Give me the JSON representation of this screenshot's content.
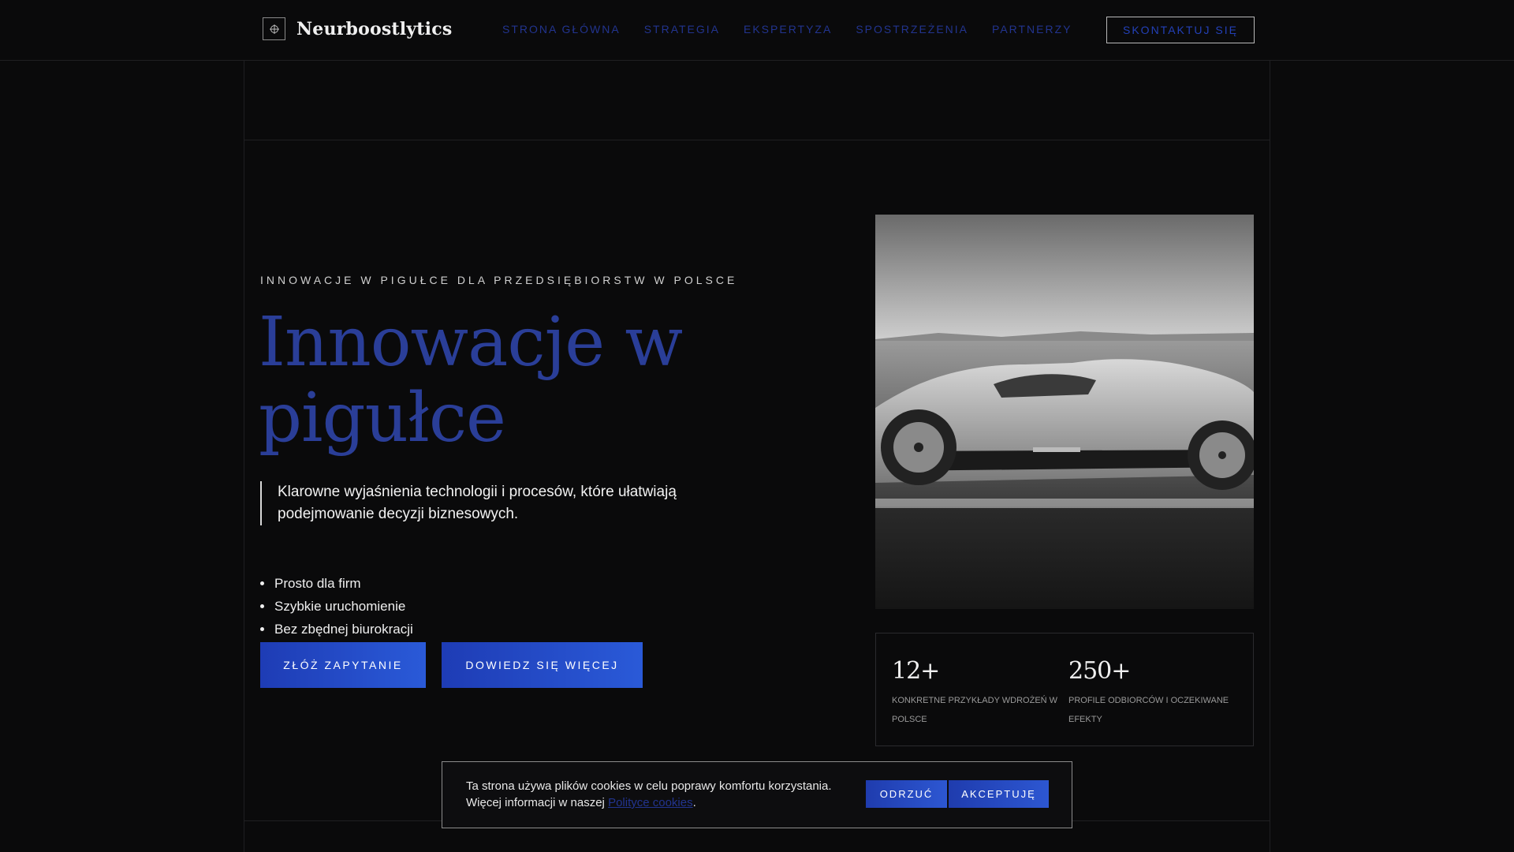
{
  "brand": {
    "name": "Neurboostlytics",
    "icon": "crosshair-icon"
  },
  "nav": {
    "items": [
      "STRONA GŁÓWNA",
      "STRATEGIA",
      "EKSPERTYZA",
      "SPOSTRZEŻENIA",
      "PARTNERZY"
    ],
    "cta": "SKONTAKTUJ SIĘ"
  },
  "hero": {
    "eyebrow": "INNOWACJE W PIGUŁCE DLA PRZEDSIĘBIORSTW W POLSCE",
    "title": "Innowacje w pigułce",
    "lead": "Klarowne wyjaśnienia technologii i procesów, które ułatwiają podejmowanie decyzji biznesowych.",
    "bullets": [
      "Prosto dla firm",
      "Szybkie uruchomienie",
      "Bez zbędnej biurokracji"
    ],
    "primary_button": "ZŁÓŻ ZAPYTANIE",
    "secondary_button": "DOWIEDZ SIĘ WIĘCEJ"
  },
  "stats": [
    {
      "value": "12+",
      "label": "KONKRETNE PRZYKŁADY WDROŻEŃ W POLSCE"
    },
    {
      "value": "250+",
      "label": "PROFILE ODBIORCÓW I OCZEKIWANE EFEKTY"
    }
  ],
  "cookie": {
    "text_line1": "Ta strona używa plików cookies w celu poprawy komfortu korzystania.",
    "text_line2_prefix": "Więcej informacji w naszej ",
    "link": "Polityce cookies",
    "text_suffix": ".",
    "reject": "ODRZUĆ",
    "accept": "AKCEPTUJĘ"
  },
  "colors": {
    "accent": "#2a3e98",
    "button": "#2340b7",
    "background": "#0a0a0b"
  }
}
